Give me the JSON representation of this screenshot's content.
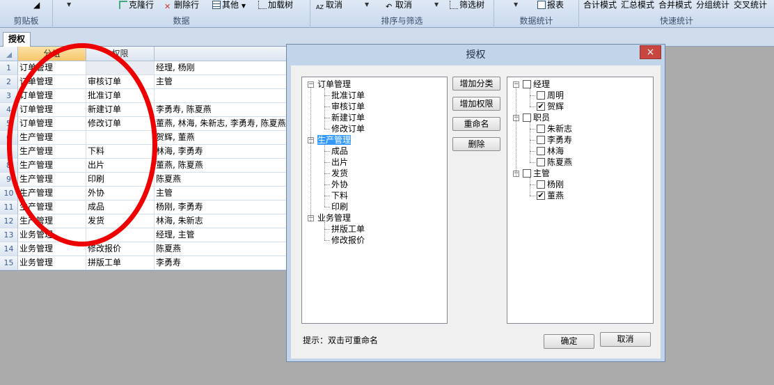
{
  "ribbon": {
    "groups": [
      {
        "label": "剪贴板"
      },
      {
        "label": "数据",
        "buttons": [
          "克隆行",
          "删除行",
          "其他",
          "加载树"
        ]
      },
      {
        "label": "排序与筛选",
        "buttons": [
          "取消",
          "取消",
          "筛选树"
        ]
      },
      {
        "label": "数据统计",
        "buttons": [
          "报表"
        ]
      },
      {
        "label": "快速统计",
        "buttons": [
          "合计模式",
          "汇总模式",
          "合并模式",
          "分组统计",
          "交叉统计"
        ]
      }
    ]
  },
  "tab": {
    "label": "授权"
  },
  "grid": {
    "headers": [
      "分组",
      "权限",
      ""
    ],
    "rows": [
      {
        "n": "1",
        "group": "订单管理",
        "perm": "",
        "users": "经理, 杨刚"
      },
      {
        "n": "2",
        "group": "订单管理",
        "perm": "审核订单",
        "users": "主管"
      },
      {
        "n": "3",
        "group": "订单管理",
        "perm": "批准订单",
        "users": ""
      },
      {
        "n": "4",
        "group": "订单管理",
        "perm": "新建订单",
        "users": "李勇寿, 陈夏燕"
      },
      {
        "n": "5",
        "group": "订单管理",
        "perm": "修改订单",
        "users": "董燕, 林海, 朱新志, 李勇寿, 陈夏燕"
      },
      {
        "n": "6",
        "group": "生产管理",
        "perm": "",
        "users": "贺辉, 董燕"
      },
      {
        "n": "7",
        "group": "生产管理",
        "perm": "下料",
        "users": "林海, 李勇寿"
      },
      {
        "n": "8",
        "group": "生产管理",
        "perm": "出片",
        "users": "董燕, 陈夏燕"
      },
      {
        "n": "9",
        "group": "生产管理",
        "perm": "印刷",
        "users": "陈夏燕"
      },
      {
        "n": "10",
        "group": "生产管理",
        "perm": "外协",
        "users": "主管"
      },
      {
        "n": "11",
        "group": "生产管理",
        "perm": "成品",
        "users": "杨刚, 李勇寿"
      },
      {
        "n": "12",
        "group": "生产管理",
        "perm": "发货",
        "users": "林海, 朱新志"
      },
      {
        "n": "13",
        "group": "业务管理",
        "perm": "",
        "users": "经理, 主管"
      },
      {
        "n": "14",
        "group": "业务管理",
        "perm": "修改报价",
        "users": "陈夏燕"
      },
      {
        "n": "15",
        "group": "业务管理",
        "perm": "拼版工单",
        "users": "李勇寿"
      }
    ]
  },
  "dialog": {
    "title": "授权",
    "close": "×",
    "left_tree": [
      {
        "label": "订单管理",
        "level": 0,
        "expander": "−"
      },
      {
        "label": "批准订单",
        "level": 1
      },
      {
        "label": "审核订单",
        "level": 1
      },
      {
        "label": "新建订单",
        "level": 1
      },
      {
        "label": "修改订单",
        "level": 1
      },
      {
        "label": "生产管理",
        "level": 0,
        "expander": "−",
        "selected": true
      },
      {
        "label": "成品",
        "level": 1
      },
      {
        "label": "出片",
        "level": 1
      },
      {
        "label": "发货",
        "level": 1
      },
      {
        "label": "外协",
        "level": 1
      },
      {
        "label": "下料",
        "level": 1
      },
      {
        "label": "印刷",
        "level": 1
      },
      {
        "label": "业务管理",
        "level": 0,
        "expander": "−"
      },
      {
        "label": "拼版工单",
        "level": 1
      },
      {
        "label": "修改报价",
        "level": 1
      }
    ],
    "buttons": [
      "增加分类",
      "增加权限",
      "重命名",
      "删除"
    ],
    "right_tree": [
      {
        "label": "经理",
        "level": 0,
        "checked": false,
        "expander": "−"
      },
      {
        "label": "周明",
        "level": 1,
        "checked": false
      },
      {
        "label": "贺辉",
        "level": 1,
        "checked": true
      },
      {
        "label": "职员",
        "level": 0,
        "checked": false,
        "expander": "−"
      },
      {
        "label": "朱新志",
        "level": 1,
        "checked": false
      },
      {
        "label": "李勇寿",
        "level": 1,
        "checked": false
      },
      {
        "label": "林海",
        "level": 1,
        "checked": false
      },
      {
        "label": "陈夏燕",
        "level": 1,
        "checked": false
      },
      {
        "label": "主管",
        "level": 0,
        "checked": false,
        "expander": "−"
      },
      {
        "label": "杨刚",
        "level": 1,
        "checked": false
      },
      {
        "label": "董燕",
        "level": 1,
        "checked": true
      }
    ],
    "hint": "提示：双击可重命名",
    "ok": "确定",
    "cancel": "取消"
  },
  "colors": {
    "annotation": "#ee0000",
    "selection": "#3399ff",
    "close_button": "#c7463f"
  }
}
